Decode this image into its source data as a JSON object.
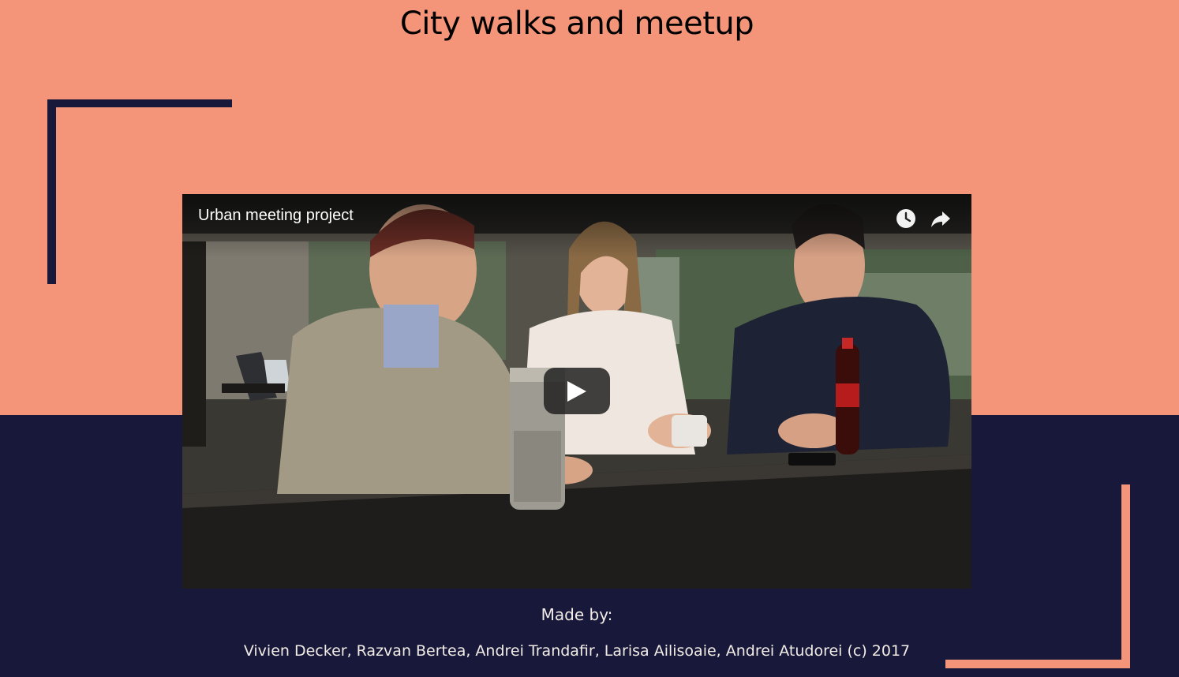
{
  "page": {
    "title": "City walks and meetup"
  },
  "video": {
    "title": "Urban meeting project",
    "icons": {
      "watch_later": "clock-icon",
      "share": "share-arrow-icon",
      "play": "play-icon"
    }
  },
  "footer": {
    "made_by": "Made by:",
    "credits": "Vivien Decker, Razvan Bertea, Andrei Trandafir, Larisa Ailisoaie, Andrei Atudorei (c) 2017"
  },
  "colors": {
    "salmon": "#f49478",
    "navy": "#18183a",
    "footer_text": "#f2ece6"
  }
}
